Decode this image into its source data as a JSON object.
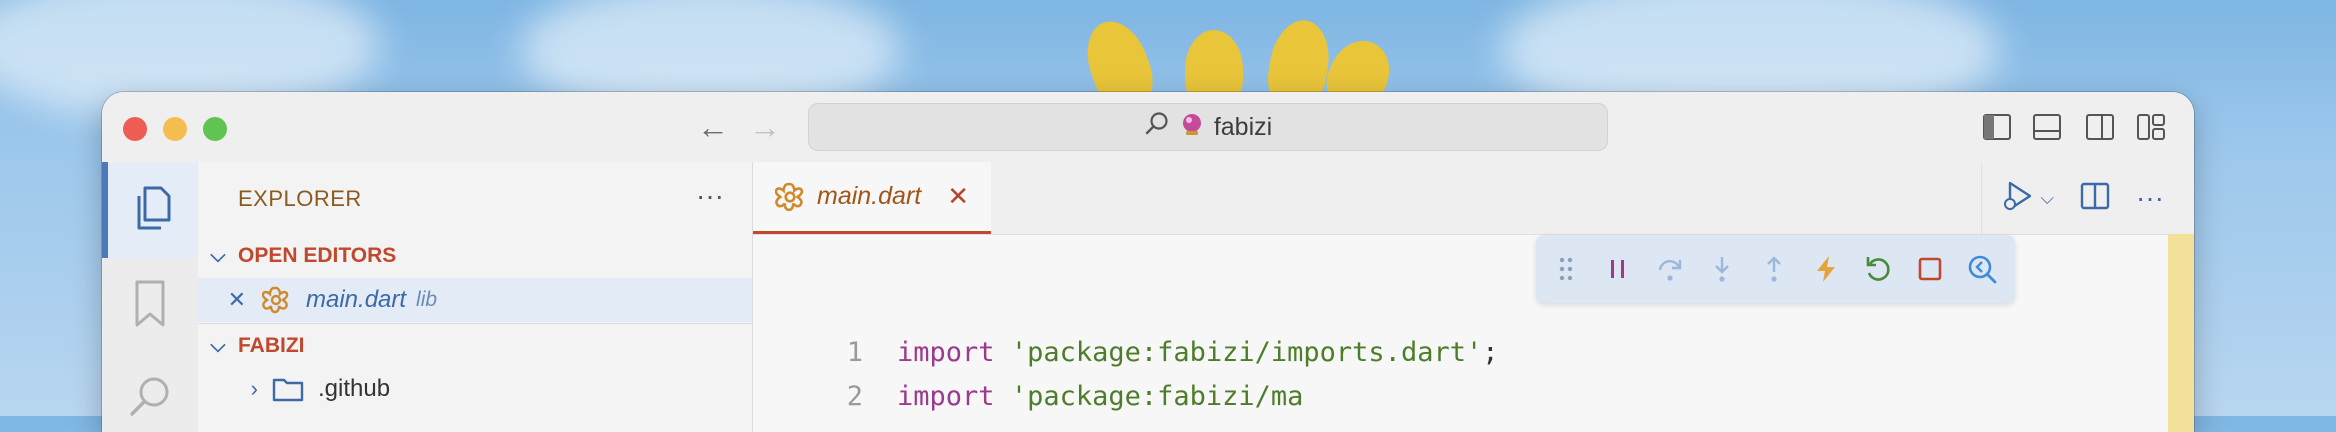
{
  "titlebar": {
    "back_arrow": "←",
    "forward_arrow": "→",
    "search_text": "fabizi"
  },
  "sidebar": {
    "title": "EXPLORER",
    "more": "···",
    "open_editors_label": "OPEN EDITORS",
    "open_editor": {
      "close": "✕",
      "file": "main.dart",
      "folder": "lib"
    },
    "project_label": "FABIZI",
    "tree": [
      {
        "name": ".github",
        "type": "folder"
      }
    ]
  },
  "editor": {
    "tab_label": "main.dart",
    "tab_close": "✕",
    "actions_more": "···",
    "lines": [
      {
        "number": "1",
        "keyword": "import",
        "string": "'package:fabizi/imports.dart'",
        "end": ";"
      },
      {
        "number": "2",
        "keyword": "import",
        "string": "'package:fabizi/ma",
        "end": ""
      }
    ]
  },
  "colors": {
    "accent": "#c0482d",
    "folder_title": "#8a5a1f",
    "link_blue": "#3b6aa6",
    "dart_icon": "#d08a2c"
  },
  "icons": {
    "explorer": "files-icon",
    "bookmarks": "bookmark-icon",
    "search": "search-icon",
    "debug_controls": [
      "drag-handle-icon",
      "pause-icon",
      "step-over-icon",
      "step-into-icon",
      "step-out-icon",
      "hot-reload-icon",
      "restart-icon",
      "stop-icon",
      "devtools-icon"
    ]
  }
}
